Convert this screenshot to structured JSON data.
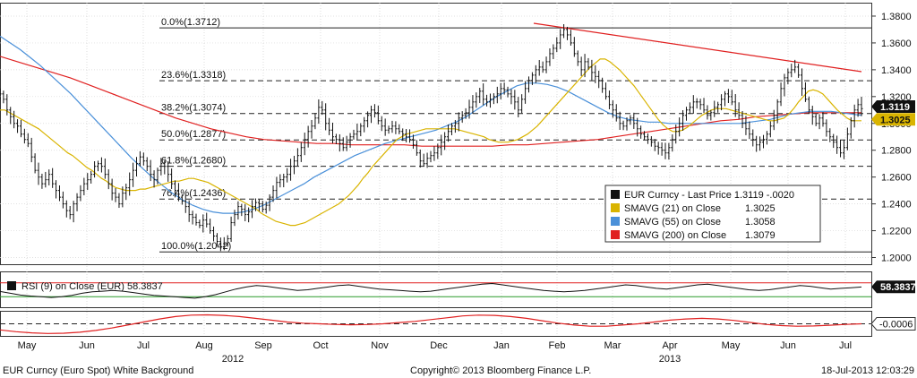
{
  "chart_data": {
    "type": "line",
    "instrument": "EUR Curncy",
    "price_panel": {
      "y_ticks": [
        "1.3800",
        "1.3600",
        "1.3400",
        "1.3200",
        "1.3000",
        "1.2800",
        "1.2600",
        "1.2400",
        "1.2200",
        "1.2000"
      ],
      "ylim": [
        1.195,
        1.39
      ],
      "last_price_tag": "1.3119",
      "sma21_tag": "1.3025",
      "fib_levels": [
        {
          "label": "0.0%(1.3712)",
          "value": 1.3712
        },
        {
          "label": "23.6%(1.3318)",
          "value": 1.3318
        },
        {
          "label": "38.2%(1.3074)",
          "value": 1.3074
        },
        {
          "label": "50.0%(1.2877)",
          "value": 1.2877
        },
        {
          "label": "61.8%(1.2680)",
          "value": 1.268
        },
        {
          "label": "76.4%(1.2436)",
          "value": 1.2436
        },
        {
          "label": "100.0%(1.2042)",
          "value": 1.2042
        }
      ],
      "price": [
        1.322,
        1.318,
        1.31,
        1.305,
        1.3,
        1.298,
        1.292,
        1.288,
        1.285,
        1.275,
        1.265,
        1.26,
        1.255,
        1.258,
        1.262,
        1.255,
        1.25,
        1.245,
        1.24,
        1.235,
        1.232,
        1.24,
        1.245,
        1.25,
        1.255,
        1.258,
        1.262,
        1.268,
        1.27,
        1.268,
        1.262,
        1.255,
        1.248,
        1.245,
        1.24,
        1.248,
        1.252,
        1.258,
        1.265,
        1.27,
        1.275,
        1.272,
        1.268,
        1.262,
        1.258,
        1.265,
        1.27,
        1.268,
        1.262,
        1.255,
        1.25,
        1.245,
        1.242,
        1.238,
        1.232,
        1.23,
        1.226,
        1.224,
        1.228,
        1.225,
        1.22,
        1.216,
        1.212,
        1.208,
        1.21,
        1.214,
        1.226,
        1.232,
        1.238,
        1.236,
        1.232,
        1.234,
        1.238,
        1.241,
        1.24,
        1.236,
        1.239,
        1.245,
        1.25,
        1.256,
        1.258,
        1.26,
        1.262,
        1.268,
        1.272,
        1.276,
        1.282,
        1.288,
        1.294,
        1.298,
        1.304,
        1.312,
        1.31,
        1.3,
        1.295,
        1.29,
        1.288,
        1.285,
        1.282,
        1.286,
        1.29,
        1.292,
        1.294,
        1.298,
        1.302,
        1.306,
        1.31,
        1.308,
        1.302,
        1.298,
        1.295,
        1.296,
        1.298,
        1.296,
        1.294,
        1.292,
        1.29,
        1.288,
        1.284,
        1.278,
        1.272,
        1.27,
        1.274,
        1.276,
        1.278,
        1.282,
        1.286,
        1.29,
        1.294,
        1.298,
        1.3,
        1.304,
        1.306,
        1.308,
        1.312,
        1.316,
        1.32,
        1.324,
        1.318,
        1.316,
        1.318,
        1.32,
        1.322,
        1.326,
        1.325,
        1.322,
        1.32,
        1.316,
        1.31,
        1.318,
        1.326,
        1.332,
        1.336,
        1.34,
        1.342,
        1.34,
        1.346,
        1.352,
        1.356,
        1.36,
        1.366,
        1.37,
        1.366,
        1.36,
        1.352,
        1.346,
        1.34,
        1.346,
        1.342,
        1.338,
        1.335,
        1.332,
        1.326,
        1.32,
        1.314,
        1.31,
        1.304,
        1.3,
        1.298,
        1.302,
        1.304,
        1.3,
        1.296,
        1.292,
        1.29,
        1.288,
        1.286,
        1.283,
        1.282,
        1.28,
        1.278,
        1.282,
        1.288,
        1.294,
        1.3,
        1.306,
        1.31,
        1.312,
        1.316,
        1.316,
        1.314,
        1.31,
        1.306,
        1.308,
        1.312,
        1.314,
        1.318,
        1.322,
        1.32,
        1.316,
        1.31,
        1.306,
        1.3,
        1.296,
        1.292,
        1.288,
        1.284,
        1.286,
        1.288,
        1.292,
        1.298,
        1.306,
        1.316,
        1.326,
        1.334,
        1.338,
        1.34,
        1.342,
        1.336,
        1.326,
        1.318,
        1.31,
        1.305,
        1.3,
        1.304,
        1.3,
        1.294,
        1.29,
        1.286,
        1.282,
        1.278,
        1.282,
        1.292,
        1.302,
        1.31,
        1.314,
        1.311
      ],
      "sma21": [
        1.31,
        1.31,
        1.308,
        1.306,
        1.304,
        1.302,
        1.3,
        1.298,
        1.296,
        1.293,
        1.29,
        1.287,
        1.284,
        1.281,
        1.278,
        1.276,
        1.273,
        1.27,
        1.267,
        1.265,
        1.262,
        1.259,
        1.257,
        1.254,
        1.252,
        1.251,
        1.25,
        1.25,
        1.25,
        1.251,
        1.251,
        1.252,
        1.253,
        1.254,
        1.255,
        1.256,
        1.257,
        1.257,
        1.258,
        1.259,
        1.259,
        1.258,
        1.257,
        1.256,
        1.254,
        1.252,
        1.25,
        1.248,
        1.246,
        1.244,
        1.242,
        1.24,
        1.238,
        1.236,
        1.233,
        1.231,
        1.229,
        1.227,
        1.226,
        1.225,
        1.224,
        1.224,
        1.225,
        1.226,
        1.228,
        1.23,
        1.232,
        1.234,
        1.236,
        1.238,
        1.24,
        1.243,
        1.246,
        1.25,
        1.254,
        1.259,
        1.263,
        1.268,
        1.272,
        1.276,
        1.28,
        1.284,
        1.288,
        1.29,
        1.292,
        1.293,
        1.294,
        1.295,
        1.296,
        1.296,
        1.296,
        1.296,
        1.296,
        1.296,
        1.296,
        1.295,
        1.294,
        1.293,
        1.292,
        1.291,
        1.29,
        1.288,
        1.287,
        1.286,
        1.286,
        1.286,
        1.287,
        1.288,
        1.29,
        1.292,
        1.295,
        1.298,
        1.302,
        1.306,
        1.31,
        1.314,
        1.318,
        1.322,
        1.326,
        1.33,
        1.334,
        1.338,
        1.342,
        1.345,
        1.348,
        1.348,
        1.346,
        1.343,
        1.34,
        1.336,
        1.332,
        1.328,
        1.323,
        1.318,
        1.313,
        1.308,
        1.303,
        1.299,
        1.296,
        1.294,
        1.294,
        1.295,
        1.297,
        1.3,
        1.303,
        1.306,
        1.308,
        1.31,
        1.311,
        1.311,
        1.311,
        1.31,
        1.309,
        1.308,
        1.307,
        1.306,
        1.305,
        1.304,
        1.303,
        1.302,
        1.302,
        1.303,
        1.304,
        1.307,
        1.311,
        1.316,
        1.32,
        1.324,
        1.325,
        1.324,
        1.322,
        1.318,
        1.314,
        1.31,
        1.307,
        1.304,
        1.302,
        1.302,
        1.302
      ],
      "sma55": [
        1.365,
        1.36,
        1.355,
        1.349,
        1.343,
        1.336,
        1.329,
        1.322,
        1.314,
        1.306,
        1.298,
        1.29,
        1.282,
        1.274,
        1.267,
        1.26,
        1.254,
        1.248,
        1.243,
        1.239,
        1.236,
        1.234,
        1.233,
        1.233,
        1.234,
        1.236,
        1.239,
        1.243,
        1.247,
        1.251,
        1.255,
        1.26,
        1.264,
        1.268,
        1.272,
        1.276,
        1.279,
        1.282,
        1.285,
        1.287,
        1.289,
        1.291,
        1.293,
        1.295,
        1.298,
        1.301,
        1.305,
        1.31,
        1.315,
        1.32,
        1.324,
        1.328,
        1.33,
        1.33,
        1.329,
        1.327,
        1.324,
        1.32,
        1.316,
        1.312,
        1.308,
        1.305,
        1.303,
        1.302,
        1.301,
        1.301,
        1.3,
        1.3,
        1.3,
        1.3,
        1.3,
        1.3,
        1.3,
        1.3,
        1.301,
        1.302,
        1.303,
        1.305,
        1.307,
        1.308,
        1.309,
        1.309,
        1.309,
        1.308,
        1.307,
        1.306
      ],
      "sma200": [
        1.35,
        1.346,
        1.342,
        1.338,
        1.334,
        1.329,
        1.324,
        1.319,
        1.314,
        1.309,
        1.304,
        1.3,
        1.296,
        1.293,
        1.29,
        1.288,
        1.287,
        1.286,
        1.285,
        1.285,
        1.284,
        1.284,
        1.284,
        1.284,
        1.283,
        1.283,
        1.283,
        1.283,
        1.283,
        1.284,
        1.284,
        1.285,
        1.286,
        1.287,
        1.288,
        1.29,
        1.292,
        1.294,
        1.296,
        1.298,
        1.3,
        1.302,
        1.303,
        1.305,
        1.306,
        1.307,
        1.308,
        1.308,
        1.308,
        1.308
      ]
    },
    "legend": {
      "title": "EUR Curncy - Last Price",
      "title_value": "1.3119",
      "title_change": "-.0020",
      "items": [
        {
          "name": "SMAVG (21)  on Close",
          "value": "1.3025",
          "color": "#d9b400"
        },
        {
          "name": "SMAVG (55)  on Close",
          "value": "1.3058",
          "color": "#4a90d9"
        },
        {
          "name": "SMAVG (200)  on Close",
          "value": "1.3079",
          "color": "#e02020"
        }
      ]
    },
    "rsi_panel": {
      "label": "RSI (9) on Close (EUR)",
      "value_text": "58.3837",
      "tag": "58.3837",
      "ylim": [
        0,
        100
      ],
      "upper": 70,
      "lower": 30,
      "values": [
        45,
        40,
        35,
        32,
        30,
        28,
        30,
        34,
        40,
        44,
        46,
        48,
        46,
        42,
        38,
        34,
        32,
        30,
        28,
        26,
        30,
        36,
        44,
        52,
        58,
        62,
        60,
        56,
        52,
        48,
        50,
        54,
        58,
        62,
        64,
        60,
        56,
        52,
        50,
        48,
        46,
        44,
        46,
        50,
        54,
        58,
        62,
        66,
        68,
        64,
        60,
        56,
        52,
        48,
        46,
        44,
        46,
        48,
        52,
        56,
        60,
        64,
        62,
        58,
        54,
        52,
        56,
        60,
        64,
        66,
        62,
        58,
        54,
        50,
        48,
        50,
        54,
        58,
        62,
        60,
        56,
        52,
        54,
        56,
        58
      ]
    },
    "osc_panel": {
      "tag": "-0.0006",
      "ylim": [
        -1,
        1
      ],
      "values": [
        -0.5,
        -0.65,
        -0.75,
        -0.8,
        -0.78,
        -0.7,
        -0.55,
        -0.35,
        -0.1,
        0.15,
        0.4,
        0.6,
        0.72,
        0.74,
        0.7,
        0.6,
        0.45,
        0.3,
        0.15,
        0.05,
        0.0,
        -0.05,
        -0.08,
        -0.06,
        0.0,
        0.1,
        0.2,
        0.35,
        0.5,
        0.65,
        0.72,
        0.7,
        0.6,
        0.45,
        0.25,
        0.05,
        -0.1,
        -0.2,
        -0.2,
        -0.1,
        0.0,
        0.15,
        0.3,
        0.4,
        0.45,
        0.4,
        0.28,
        0.12,
        -0.05,
        -0.15,
        -0.2,
        -0.18,
        -0.12,
        -0.05,
        0.0
      ]
    },
    "x_months": [
      "May",
      "Jun",
      "Jul",
      "Aug",
      "Sep",
      "Oct",
      "Nov",
      "Dec",
      "Jan",
      "Feb",
      "Mar",
      "Apr",
      "May",
      "Jun",
      "Jul"
    ],
    "x_years": [
      "2012",
      "2013"
    ],
    "grid": true
  },
  "footer": {
    "left": "EUR Curncy (Euro Spot) White Background",
    "center": "Copyright© 2013 Bloomberg Finance L.P.",
    "right": "18-Jul-2013 12:03:29"
  }
}
